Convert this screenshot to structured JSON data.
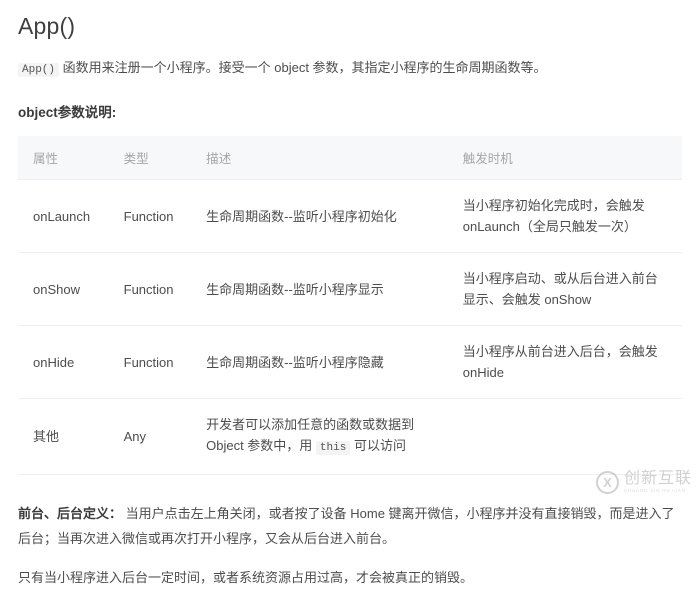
{
  "doc": {
    "title": "App()",
    "intro": {
      "code": "App()",
      "text": "函数用来注册一个小程序。接受一个 object 参数，其指定小程序的生命周期函数等。"
    },
    "section_label": "object参数说明:"
  },
  "table": {
    "headers": [
      "属性",
      "类型",
      "描述",
      "触发时机"
    ],
    "rows": [
      {
        "attr": "onLaunch",
        "type": "Function",
        "desc": "生命周期函数--监听小程序初始化",
        "trigger_line1": "当小程序初始化完成时，会触发",
        "trigger_line2": "onLaunch（全局只触发一次）"
      },
      {
        "attr": "onShow",
        "type": "Function",
        "desc": "生命周期函数--监听小程序显示",
        "trigger_line1": "当小程序启动、或从后台进入前台",
        "trigger_line2": "显示、会触发 onShow"
      },
      {
        "attr": "onHide",
        "type": "Function",
        "desc": "生命周期函数--监听小程序隐藏",
        "trigger_line1": "当小程序从前台进入后台，会触发",
        "trigger_line2": "onHide"
      },
      {
        "attr": "其他",
        "type": "Any",
        "desc_line1": "开发者可以添加任意的函数或数据到",
        "desc_line2_before": "Object 参数中，用",
        "desc_code": "this",
        "desc_line2_after": "可以访问",
        "trigger_line1": "",
        "trigger_line2": ""
      }
    ]
  },
  "notes": {
    "note1_bold": "前台、后台定义：",
    "note1_line1": "当用户点击左上角关闭，或者按了设备 Home 键离开微信，小程序并没有直接销毁，而是进入了后台；",
    "note1_line2": "当再次进入微信或再次打开小程序，又会从后台进入前台。",
    "note2": "只有当小程序进入后台一定时间，或者系统资源占用过高，才会被真正的销毁。"
  },
  "watermark": {
    "mark": "X",
    "cn": "创新互联",
    "en": "CHUANG XIN HU LIAN"
  }
}
